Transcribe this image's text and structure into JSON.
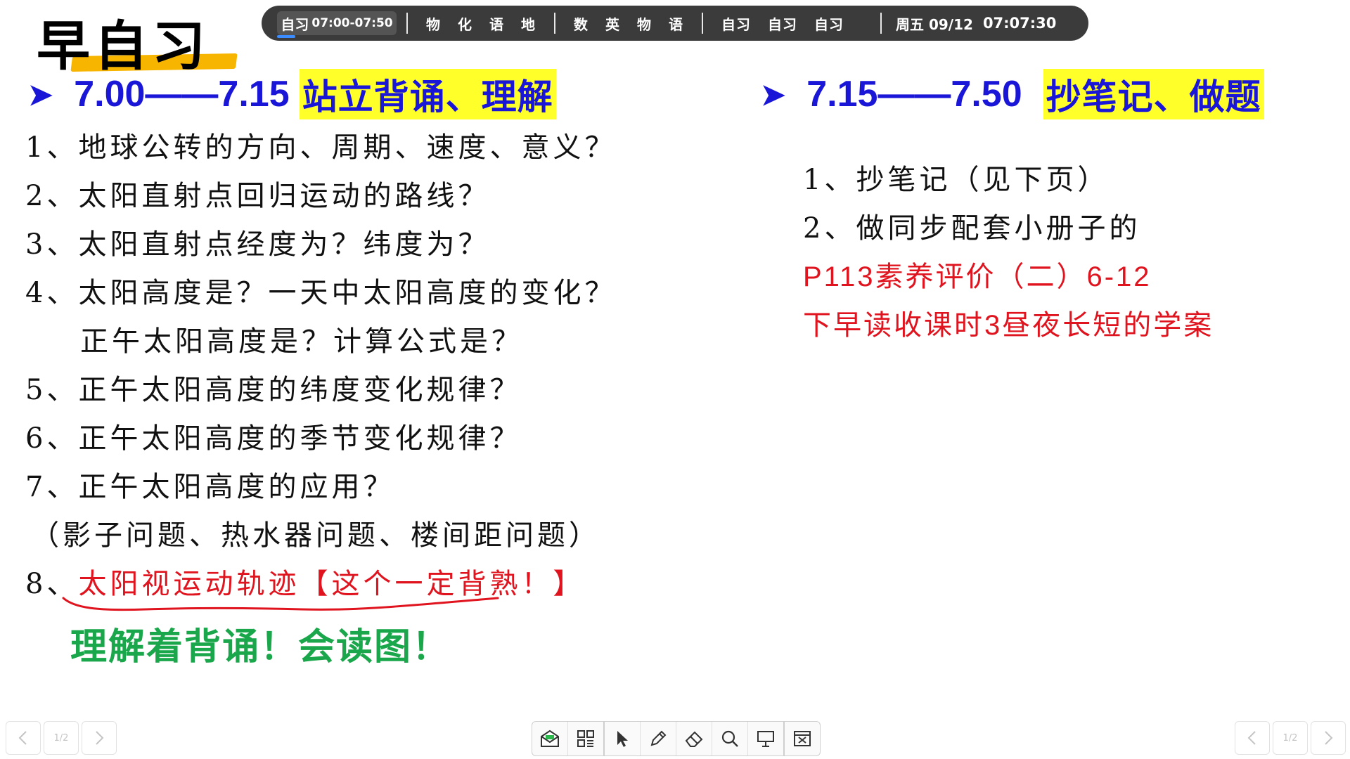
{
  "title": "早自习",
  "topbar": {
    "current_label": "自习",
    "current_time": "07:00-07:50",
    "current_progress": 0.15,
    "group1": [
      "物",
      "化",
      "语",
      "地"
    ],
    "group2": [
      "数",
      "英",
      "物",
      "语"
    ],
    "group3": [
      "自习",
      "自习",
      "自习"
    ],
    "date": "周五 09/12",
    "clock": "07:07:30"
  },
  "left_section": {
    "arrow_icon": "➤",
    "time": "7.00——7.15",
    "task": "站立背诵、理解",
    "items": [
      "1、地球公转的方向、周期、速度、意义？",
      "2、太阳直射点回归运动的路线？",
      "3、太阳直射点经度为？纬度为？",
      "4、太阳高度是？一天中太阳高度的变化？",
      "正午太阳高度是？计算公式是？",
      "5、正午太阳高度的纬度变化规律？",
      "6、正午太阳高度的季节变化规律？",
      "7、正午太阳高度的应用？",
      "（影子问题、热水器问题、楼间距问题）"
    ],
    "item8_number": "8、",
    "item8_text": "太阳视运动轨迹【这个一定背熟！】",
    "green_note": "理解着背诵！会读图！"
  },
  "right_section": {
    "arrow_icon": "➤",
    "time": "7.15——7.50",
    "task": "抄笔记、做题",
    "items": [
      "1、抄笔记（见下页）",
      "2、做同步配套小册子的"
    ],
    "red_items": [
      "P113素养评价（二）6-12",
      "下早读收课时3昼夜长短的学案"
    ]
  },
  "footer": {
    "left_page": "1/2",
    "right_page": "1/2",
    "tools": [
      "envelope-icon",
      "grid-icon",
      "cursor-icon",
      "pen-icon",
      "eraser-icon",
      "search-icon",
      "board-icon",
      "exit-icon"
    ]
  },
  "colors": {
    "heading_blue": "#1a16d8",
    "highlight_yellow": "#ffff2a",
    "title_underline": "#f7b500",
    "red_text": "#e0141e",
    "green_text": "#1aa64a",
    "topbar_bg": "#3b3b3b"
  }
}
